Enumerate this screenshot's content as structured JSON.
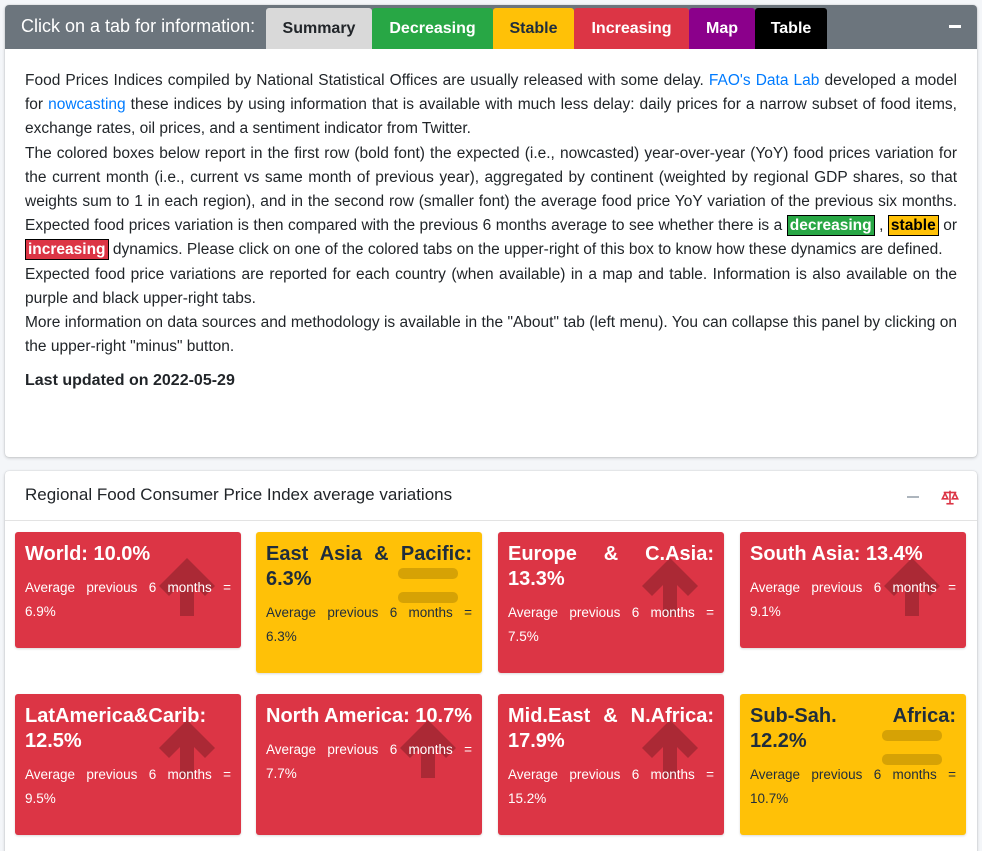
{
  "info": {
    "prompt": "Click on a tab for information:",
    "tabs": [
      "Summary",
      "Decreasing",
      "Stable",
      "Increasing",
      "Map",
      "Table"
    ],
    "p1_a": "Food Prices Indices compiled by National Statistical Offices are usually released with some delay. ",
    "p1_link1": "FAO's Data Lab",
    "p1_b": " developed a model for ",
    "p1_link2": "nowcasting",
    "p1_c": " these indices by using information that is available with much less delay: daily prices for a narrow subset of food items, exchange rates, oil prices, and a sentiment indicator from Twitter.",
    "p2_a": "The colored boxes below report in the first row (bold font) the expected (i.e., nowcasted) year-over-year (YoY) food prices variation for the current month (i.e., current vs same month of previous year), aggregated by continent (weighted by regional GDP shares, so that weights sum to 1 in each region), and in the second row (smaller font) the average food price YoY variation of the previous six months. Expected food prices variation is then compared with the previous 6 months average to see whether there is a ",
    "hl_dec": "decreasing",
    "p2_b": " , ",
    "hl_sta": "stable",
    "p2_c": " or ",
    "hl_inc": "increasing",
    "p2_d": " dynamics. Please click on one of the colored tabs on the upper-right of this box to know how these dynamics are defined.",
    "p3": "Expected food price variations are reported for each country (when available) in a map and table. Information is also available on the purple and black upper-right tabs.",
    "p4": "More information on data sources and methodology is available in the \"About\" tab (left menu). You can collapse this panel by clicking on the upper-right \"minus\" button.",
    "last_updated": "Last updated on 2022-05-29"
  },
  "regional": {
    "title": "Regional Food Consumer Price Index average variations",
    "avg_label": "Average previous 6 months =",
    "boxes": [
      {
        "name": "World:",
        "value": "10.0%",
        "avg": "6.9%",
        "status": "increasing",
        "icon": "arrow-up-icon"
      },
      {
        "name": "East Asia & Pacific:",
        "value": "6.3%",
        "avg": "6.3%",
        "status": "stable",
        "icon": "equals-icon"
      },
      {
        "name": "Europe & C.Asia:",
        "value": "13.3%",
        "avg": "7.5%",
        "status": "increasing",
        "icon": "arrow-up-icon"
      },
      {
        "name": "South Asia:",
        "value": "13.4%",
        "avg": "9.1%",
        "status": "increasing",
        "icon": "arrow-up-icon"
      },
      {
        "name": "LatAmerica&Carib:",
        "value": "12.5%",
        "avg": "9.5%",
        "status": "increasing",
        "icon": "arrow-up-icon"
      },
      {
        "name": "North America:",
        "value": "10.7%",
        "avg": "7.7%",
        "status": "increasing",
        "icon": "arrow-up-icon"
      },
      {
        "name": "Mid.East & N.Africa:",
        "value": "17.9%",
        "avg": "15.2%",
        "status": "increasing",
        "icon": "arrow-up-icon"
      },
      {
        "name": "Sub-Sah. Africa:",
        "value": "12.2%",
        "avg": "10.7%",
        "status": "stable",
        "icon": "equals-icon"
      }
    ]
  },
  "colors": {
    "increasing": "#dc3545",
    "stable": "#ffc107",
    "decreasing": "#28a745",
    "header": "#6c757d"
  }
}
